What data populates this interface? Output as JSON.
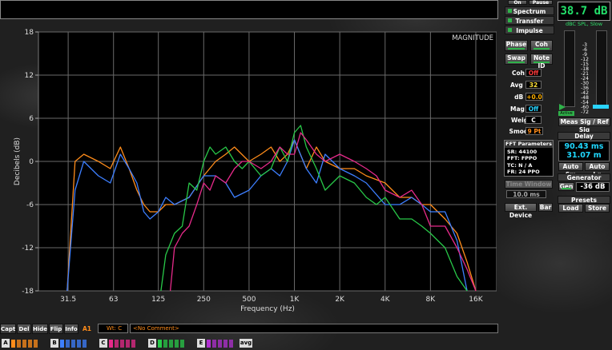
{
  "meter": {
    "level": "38.7 dB",
    "mode": "dBC SPL, Slow"
  },
  "top_buttons": {
    "on": "On",
    "pause": "Pause"
  },
  "view_tabs": [
    "Spectrum",
    "Transfer",
    "Impulse"
  ],
  "panel": {
    "phase": "Phase",
    "coh": "Coh",
    "swap": "Swap",
    "note_id": "Note ID",
    "coh_th_label": "Coh Th",
    "coh_th_value": "Off",
    "avg_label": "Avg (R)",
    "avg_value": "32",
    "db_label": "dB +/-",
    "db_value": "+0.0",
    "mag_th_label": "Mag Th",
    "mag_th_value": "Off",
    "weight_label": "Weight",
    "weight_value": "C",
    "smooth_label": "Smooth",
    "smooth_value": "9 Pt",
    "fft_title": "FFT Parameters",
    "fft_lines": [
      "SR: 44100",
      "FFT: FPPO",
      "TC: N / A",
      "FR: 24 PPO"
    ],
    "time_window": "Time Window",
    "time_window_value": "10.0 ms",
    "ext_device": "Ext. Device",
    "bar": "Bar"
  },
  "meter_panel": {
    "scale": [
      "-3",
      "-6",
      "-9",
      "-12",
      "-15",
      "-18",
      "-21",
      "-24",
      "-30",
      "-36",
      "-42",
      "-48",
      "-54",
      "-60",
      "-72"
    ],
    "active": "Active",
    "meas_ref": "Meas Sig / Ref Sig",
    "delay_title": "Delay",
    "delay_ms": "90.43 ms",
    "delay_ft": "31.07 m",
    "auto_sm": "Auto Sm",
    "auto_lg": "Auto Lg",
    "generator_title": "Generator",
    "gen": "Gen",
    "gen_level": "-36 dB",
    "presets_title": "Presets",
    "load": "Load",
    "store": "Store"
  },
  "bottom": {
    "buttons": [
      "Capt",
      "Del",
      "Hide",
      "Flip",
      "Info"
    ],
    "slot": "A1",
    "wt": "Wt: C",
    "comment": "<No Comment>",
    "groups": [
      "A",
      "B",
      "C",
      "D",
      "E"
    ],
    "avg": "avg"
  },
  "chart_data": {
    "type": "line",
    "title": "MAGNITUDE",
    "xlabel": "Frequency (Hz)",
    "ylabel": "Decibels (dB)",
    "x_scale": "log",
    "xlim": [
      20,
      22000
    ],
    "ylim": [
      -18,
      18
    ],
    "x_ticks": [
      31.5,
      63,
      125,
      250,
      500,
      1000,
      2000,
      4000,
      8000,
      16000
    ],
    "x_tick_labels": [
      "31.5",
      "63",
      "125",
      "250",
      "500",
      "1K",
      "2K",
      "4K",
      "8K",
      "16K"
    ],
    "y_ticks": [
      18,
      12,
      6,
      0,
      -6,
      -12,
      -18
    ],
    "y_tick_labels": [
      "18",
      "12",
      "6",
      "0",
      "-6",
      "-12",
      "-18"
    ],
    "grid": true,
    "series": [
      {
        "color": "#ff8c1a",
        "x": [
          31,
          35,
          40,
          50,
          60,
          70,
          80,
          90,
          100,
          110,
          125,
          140,
          160,
          200,
          250,
          300,
          350,
          400,
          500,
          600,
          700,
          800,
          900,
          1000,
          1200,
          1400,
          1600,
          2000,
          2500,
          3000,
          4000,
          5000,
          6000,
          7000,
          8000,
          10000,
          12000,
          14000,
          16000
        ],
        "y": [
          -18,
          0,
          1,
          0,
          -1,
          2,
          -1,
          -4,
          -6,
          -7,
          -7,
          -6,
          -6,
          -5,
          -2,
          0,
          1,
          2,
          0,
          1,
          2,
          0,
          1,
          3,
          -1,
          2,
          0,
          -1,
          -1,
          -2,
          -3,
          -5,
          -5,
          -6,
          -6,
          -8,
          -10,
          -14,
          -18
        ]
      },
      {
        "color": "#3d7fff",
        "x": [
          31,
          35,
          40,
          50,
          60,
          70,
          80,
          90,
          100,
          110,
          125,
          140,
          160,
          200,
          250,
          300,
          350,
          400,
          500,
          600,
          700,
          800,
          900,
          1000,
          1200,
          1400,
          1600,
          2000,
          2500,
          3000,
          4000,
          5000,
          6000,
          7000,
          8000,
          10000,
          12000,
          14000
        ],
        "y": [
          -18,
          -4,
          0,
          -2,
          -3,
          1,
          -1,
          -3,
          -7,
          -8,
          -7,
          -5,
          -6,
          -5,
          -2,
          -2,
          -3,
          -5,
          -4,
          -2,
          -1,
          -2,
          0,
          3,
          -1,
          -3,
          1,
          -1,
          -2,
          -3,
          -6,
          -6,
          -5,
          -6,
          -7,
          -7,
          -11,
          -18
        ]
      },
      {
        "color": "#28c848",
        "x": [
          130,
          140,
          160,
          180,
          200,
          225,
          250,
          275,
          300,
          350,
          400,
          450,
          500,
          600,
          700,
          800,
          900,
          1000,
          1100,
          1200,
          1400,
          1600,
          2000,
          2500,
          3000,
          3500,
          4000,
          5000,
          6000,
          7000,
          8000,
          10000,
          12000,
          14000
        ],
        "y": [
          -18,
          -13,
          -10,
          -9,
          -3,
          -4,
          0,
          2,
          1,
          2,
          0,
          -1,
          0,
          -2,
          -1,
          2,
          0,
          4,
          5,
          2,
          -1,
          -4,
          -2,
          -3,
          -5,
          -6,
          -5,
          -8,
          -8,
          -9,
          -10,
          -12,
          -16,
          -18
        ]
      },
      {
        "color": "#e62a8a",
        "x": [
          150,
          160,
          180,
          200,
          225,
          250,
          275,
          300,
          350,
          400,
          450,
          500,
          600,
          700,
          800,
          900,
          1000,
          1100,
          1200,
          1400,
          1600,
          2000,
          2500,
          3000,
          3500,
          4000,
          5000,
          6000,
          7000,
          8000,
          10000,
          12000,
          14000,
          16000
        ],
        "y": [
          -18,
          -12,
          -10,
          -9,
          -6,
          -3,
          -4,
          -2,
          -3,
          -1,
          0,
          0,
          -1,
          0,
          2,
          1,
          1,
          4,
          3,
          1,
          0,
          1,
          0,
          -1,
          -2,
          -4,
          -5,
          -4,
          -6,
          -9,
          -9,
          -12,
          -15,
          -18
        ]
      }
    ]
  }
}
